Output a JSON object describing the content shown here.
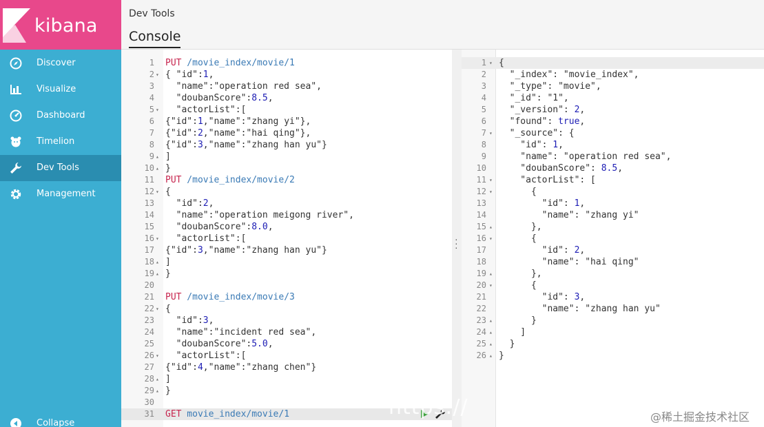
{
  "app": {
    "brand": "kibana",
    "title": "Dev Tools",
    "tab": "Console"
  },
  "colors": {
    "sidebar": "#3caed2",
    "logo_bg": "#e8488b",
    "active": "#2a8db0",
    "method": "#c7254e",
    "url": "#3a7ab5",
    "number": "#1c1cb4"
  },
  "sidebar": {
    "items": [
      {
        "label": "Discover",
        "icon": "compass-icon"
      },
      {
        "label": "Visualize",
        "icon": "bar-chart-icon"
      },
      {
        "label": "Dashboard",
        "icon": "gauge-icon"
      },
      {
        "label": "Timelion",
        "icon": "timelion-icon"
      },
      {
        "label": "Dev Tools",
        "icon": "wrench-icon",
        "active": true
      },
      {
        "label": "Management",
        "icon": "gear-icon"
      }
    ],
    "collapse": {
      "label": "Collapse",
      "icon": "collapse-icon"
    }
  },
  "editor": {
    "lines": [
      {
        "n": "1",
        "f": "",
        "t": [
          [
            "m",
            "PUT"
          ],
          [
            "u",
            " /movie_index/movie/1"
          ]
        ]
      },
      {
        "n": "2",
        "f": "▾",
        "t": [
          [
            "p",
            "{ \"id\":"
          ],
          [
            "n",
            "1"
          ],
          [
            "p",
            ","
          ]
        ]
      },
      {
        "n": "3",
        "f": "",
        "t": [
          [
            "p",
            "  \"name\":\"operation red sea\","
          ]
        ]
      },
      {
        "n": "4",
        "f": "",
        "t": [
          [
            "p",
            "  \"doubanScore\":"
          ],
          [
            "n",
            "8.5"
          ],
          [
            "p",
            ","
          ]
        ]
      },
      {
        "n": "5",
        "f": "▾",
        "t": [
          [
            "p",
            "  \"actorList\":["
          ]
        ]
      },
      {
        "n": "6",
        "f": "",
        "t": [
          [
            "p",
            "{\"id\":"
          ],
          [
            "n",
            "1"
          ],
          [
            "p",
            ",\"name\":\"zhang yi\"},"
          ]
        ]
      },
      {
        "n": "7",
        "f": "",
        "t": [
          [
            "p",
            "{\"id\":"
          ],
          [
            "n",
            "2"
          ],
          [
            "p",
            ",\"name\":\"hai qing\"},"
          ]
        ]
      },
      {
        "n": "8",
        "f": "",
        "t": [
          [
            "p",
            "{\"id\":"
          ],
          [
            "n",
            "3"
          ],
          [
            "p",
            ",\"name\":\"zhang han yu\"}"
          ]
        ]
      },
      {
        "n": "9",
        "f": "▴",
        "t": [
          [
            "p",
            "]"
          ]
        ]
      },
      {
        "n": "10",
        "f": "▴",
        "t": [
          [
            "p",
            "}"
          ]
        ]
      },
      {
        "n": "11",
        "f": "",
        "t": [
          [
            "m",
            "PUT"
          ],
          [
            "u",
            " /movie_index/movie/2"
          ]
        ]
      },
      {
        "n": "12",
        "f": "▾",
        "t": [
          [
            "p",
            "{"
          ]
        ]
      },
      {
        "n": "13",
        "f": "",
        "t": [
          [
            "p",
            "  \"id\":"
          ],
          [
            "n",
            "2"
          ],
          [
            "p",
            ","
          ]
        ]
      },
      {
        "n": "14",
        "f": "",
        "t": [
          [
            "p",
            "  \"name\":\"operation meigong river\","
          ]
        ]
      },
      {
        "n": "15",
        "f": "",
        "t": [
          [
            "p",
            "  \"doubanScore\":"
          ],
          [
            "n",
            "8.0"
          ],
          [
            "p",
            ","
          ]
        ]
      },
      {
        "n": "16",
        "f": "▾",
        "t": [
          [
            "p",
            "  \"actorList\":["
          ]
        ]
      },
      {
        "n": "17",
        "f": "",
        "t": [
          [
            "p",
            "{\"id\":"
          ],
          [
            "n",
            "3"
          ],
          [
            "p",
            ",\"name\":\"zhang han yu\"}"
          ]
        ]
      },
      {
        "n": "18",
        "f": "▴",
        "t": [
          [
            "p",
            "]"
          ]
        ]
      },
      {
        "n": "19",
        "f": "▴",
        "t": [
          [
            "p",
            "}"
          ]
        ]
      },
      {
        "n": "20",
        "f": "",
        "t": []
      },
      {
        "n": "21",
        "f": "",
        "t": [
          [
            "m",
            "PUT"
          ],
          [
            "u",
            " /movie_index/movie/3"
          ]
        ]
      },
      {
        "n": "22",
        "f": "▾",
        "t": [
          [
            "p",
            "{"
          ]
        ]
      },
      {
        "n": "23",
        "f": "",
        "t": [
          [
            "p",
            "  \"id\":"
          ],
          [
            "n",
            "3"
          ],
          [
            "p",
            ","
          ]
        ]
      },
      {
        "n": "24",
        "f": "",
        "t": [
          [
            "p",
            "  \"name\":\"incident red sea\","
          ]
        ]
      },
      {
        "n": "25",
        "f": "",
        "t": [
          [
            "p",
            "  \"doubanScore\":"
          ],
          [
            "n",
            "5.0"
          ],
          [
            "p",
            ","
          ]
        ]
      },
      {
        "n": "26",
        "f": "▾",
        "t": [
          [
            "p",
            "  \"actorList\":["
          ]
        ]
      },
      {
        "n": "27",
        "f": "",
        "t": [
          [
            "p",
            "{\"id\":"
          ],
          [
            "n",
            "4"
          ],
          [
            "p",
            ",\"name\":\"zhang chen\"}"
          ]
        ]
      },
      {
        "n": "28",
        "f": "▴",
        "t": [
          [
            "p",
            "]"
          ]
        ]
      },
      {
        "n": "29",
        "f": "▴",
        "t": [
          [
            "p",
            "}"
          ]
        ]
      },
      {
        "n": "30",
        "f": "",
        "t": []
      },
      {
        "n": "31",
        "f": "",
        "t": [
          [
            "m",
            "GET"
          ],
          [
            "u",
            " movie_index/movie/1"
          ]
        ],
        "cursor": true
      }
    ]
  },
  "response": {
    "lines": [
      {
        "n": "1",
        "f": "▾",
        "t": [
          [
            "p",
            "{"
          ]
        ]
      },
      {
        "n": "2",
        "f": "",
        "t": [
          [
            "p",
            "  \"_index\": \"movie_index\","
          ]
        ]
      },
      {
        "n": "3",
        "f": "",
        "t": [
          [
            "p",
            "  \"_type\": \"movie\","
          ]
        ]
      },
      {
        "n": "4",
        "f": "",
        "t": [
          [
            "p",
            "  \"_id\": \"1\","
          ]
        ]
      },
      {
        "n": "5",
        "f": "",
        "t": [
          [
            "p",
            "  \"_version\": "
          ],
          [
            "n",
            "2"
          ],
          [
            "p",
            ","
          ]
        ]
      },
      {
        "n": "6",
        "f": "",
        "t": [
          [
            "p",
            "  \"found\": "
          ],
          [
            "b",
            "true"
          ],
          [
            "p",
            ","
          ]
        ]
      },
      {
        "n": "7",
        "f": "▾",
        "t": [
          [
            "p",
            "  \"_source\": {"
          ]
        ]
      },
      {
        "n": "8",
        "f": "",
        "t": [
          [
            "p",
            "    \"id\": "
          ],
          [
            "n",
            "1"
          ],
          [
            "p",
            ","
          ]
        ]
      },
      {
        "n": "9",
        "f": "",
        "t": [
          [
            "p",
            "    \"name\": \"operation red sea\","
          ]
        ]
      },
      {
        "n": "10",
        "f": "",
        "t": [
          [
            "p",
            "    \"doubanScore\": "
          ],
          [
            "n",
            "8.5"
          ],
          [
            "p",
            ","
          ]
        ]
      },
      {
        "n": "11",
        "f": "▾",
        "t": [
          [
            "p",
            "    \"actorList\": ["
          ]
        ]
      },
      {
        "n": "12",
        "f": "▾",
        "t": [
          [
            "p",
            "      {"
          ]
        ]
      },
      {
        "n": "13",
        "f": "",
        "t": [
          [
            "p",
            "        \"id\": "
          ],
          [
            "n",
            "1"
          ],
          [
            "p",
            ","
          ]
        ]
      },
      {
        "n": "14",
        "f": "",
        "t": [
          [
            "p",
            "        \"name\": \"zhang yi\""
          ]
        ]
      },
      {
        "n": "15",
        "f": "▴",
        "t": [
          [
            "p",
            "      },"
          ]
        ]
      },
      {
        "n": "16",
        "f": "▾",
        "t": [
          [
            "p",
            "      {"
          ]
        ]
      },
      {
        "n": "17",
        "f": "",
        "t": [
          [
            "p",
            "        \"id\": "
          ],
          [
            "n",
            "2"
          ],
          [
            "p",
            ","
          ]
        ]
      },
      {
        "n": "18",
        "f": "",
        "t": [
          [
            "p",
            "        \"name\": \"hai qing\""
          ]
        ]
      },
      {
        "n": "19",
        "f": "▴",
        "t": [
          [
            "p",
            "      },"
          ]
        ]
      },
      {
        "n": "20",
        "f": "▾",
        "t": [
          [
            "p",
            "      {"
          ]
        ]
      },
      {
        "n": "21",
        "f": "",
        "t": [
          [
            "p",
            "        \"id\": "
          ],
          [
            "n",
            "3"
          ],
          [
            "p",
            ","
          ]
        ]
      },
      {
        "n": "22",
        "f": "",
        "t": [
          [
            "p",
            "        \"name\": \"zhang han yu\""
          ]
        ]
      },
      {
        "n": "23",
        "f": "▴",
        "t": [
          [
            "p",
            "      }"
          ]
        ]
      },
      {
        "n": "24",
        "f": "▴",
        "t": [
          [
            "p",
            "    ]"
          ]
        ]
      },
      {
        "n": "25",
        "f": "▴",
        "t": [
          [
            "p",
            "  }"
          ]
        ]
      },
      {
        "n": "26",
        "f": "▴",
        "t": [
          [
            "p",
            "}"
          ]
        ]
      }
    ]
  },
  "watermark": {
    "url": "https://",
    "brand": "@稀土掘金技术社区"
  }
}
